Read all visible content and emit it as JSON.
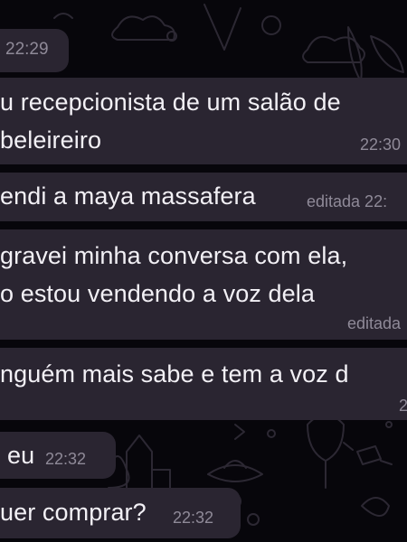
{
  "chat": {
    "messages": [
      {
        "lines": [],
        "time": "22:29"
      },
      {
        "lines": [
          "u recepcionista de um salão de",
          "beleireiro"
        ],
        "time": "22:30"
      },
      {
        "lines": [
          "endi a maya massafera"
        ],
        "edited": "editada 22:"
      },
      {
        "lines": [
          "gravei minha conversa com ela,",
          "o estou vendendo a voz dela"
        ],
        "edited": "editada"
      },
      {
        "lines": [
          "nguém mais sabe e tem a voz d"
        ],
        "time": "2"
      },
      {
        "lines": [
          "eu"
        ],
        "time": "22:32"
      },
      {
        "lines": [
          "uer comprar?"
        ],
        "time": "22:32"
      }
    ]
  },
  "theme": {
    "background": "#07060b",
    "bubble_color": "#2a2531",
    "text_color": "#f2f0f5",
    "meta_color": "#8f8a98",
    "doodle_color": "#2c2833"
  }
}
